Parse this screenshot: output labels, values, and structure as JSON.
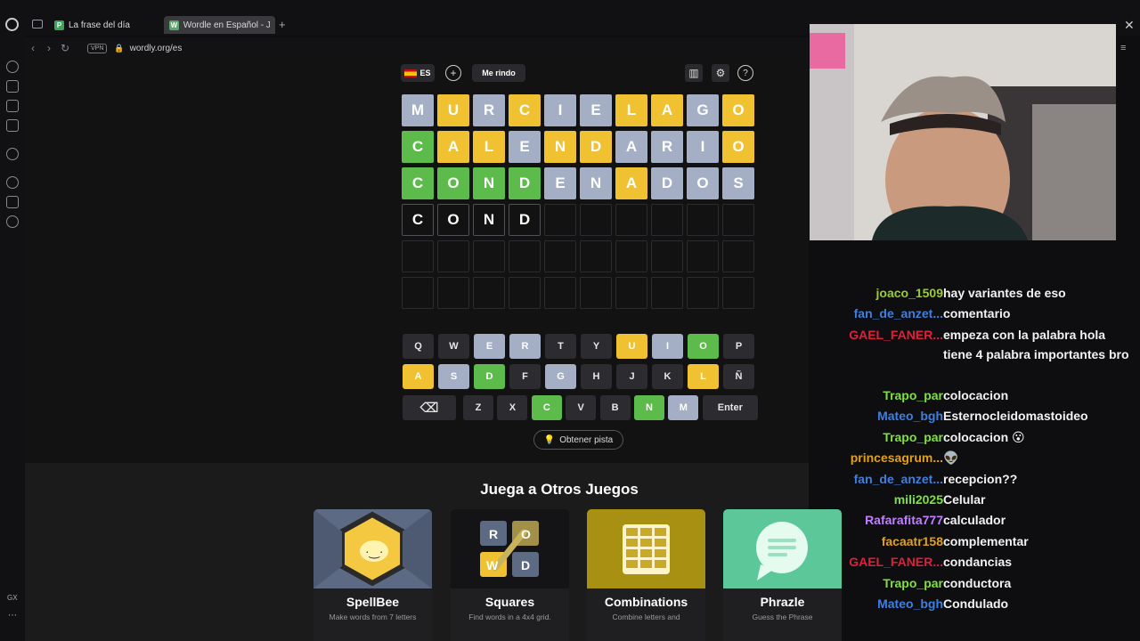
{
  "browser": {
    "tabs": [
      {
        "label": "La frase del día",
        "favicon": "P"
      },
      {
        "label": "Wordle en Español - Jueg",
        "favicon": "W"
      }
    ],
    "new_tab": "+",
    "vpn": "VPN",
    "url": "wordly.org/es"
  },
  "topbar": {
    "lang": "ES",
    "give_up": "Me rindo"
  },
  "board": {
    "rows": [
      [
        [
          "M",
          "a"
        ],
        [
          "U",
          "y"
        ],
        [
          "R",
          "a"
        ],
        [
          "C",
          "y"
        ],
        [
          "I",
          "a"
        ],
        [
          "E",
          "a"
        ],
        [
          "L",
          "y"
        ],
        [
          "A",
          "y"
        ],
        [
          "G",
          "a"
        ],
        [
          "O",
          "y"
        ]
      ],
      [
        [
          "C",
          "g"
        ],
        [
          "A",
          "y"
        ],
        [
          "L",
          "y"
        ],
        [
          "E",
          "a"
        ],
        [
          "N",
          "y"
        ],
        [
          "D",
          "y"
        ],
        [
          "A",
          "a"
        ],
        [
          "R",
          "a"
        ],
        [
          "I",
          "a"
        ],
        [
          "O",
          "y"
        ]
      ],
      [
        [
          "C",
          "g"
        ],
        [
          "O",
          "g"
        ],
        [
          "N",
          "g"
        ],
        [
          "D",
          "g"
        ],
        [
          "E",
          "a"
        ],
        [
          "N",
          "a"
        ],
        [
          "A",
          "y"
        ],
        [
          "D",
          "a"
        ],
        [
          "O",
          "a"
        ],
        [
          "S",
          "a"
        ]
      ],
      [
        [
          "C",
          "t"
        ],
        [
          "O",
          "t"
        ],
        [
          "N",
          "t"
        ],
        [
          "D",
          "t"
        ],
        [
          "",
          "e"
        ],
        [
          "",
          "e"
        ],
        [
          "",
          "e"
        ],
        [
          "",
          "e"
        ],
        [
          "",
          "e"
        ],
        [
          "",
          "e"
        ]
      ],
      [
        [
          "",
          "e"
        ],
        [
          "",
          "e"
        ],
        [
          "",
          "e"
        ],
        [
          "",
          "e"
        ],
        [
          "",
          "e"
        ],
        [
          "",
          "e"
        ],
        [
          "",
          "e"
        ],
        [
          "",
          "e"
        ],
        [
          "",
          "e"
        ],
        [
          "",
          "e"
        ]
      ],
      [
        [
          "",
          "e"
        ],
        [
          "",
          "e"
        ],
        [
          "",
          "e"
        ],
        [
          "",
          "e"
        ],
        [
          "",
          "e"
        ],
        [
          "",
          "e"
        ],
        [
          "",
          "e"
        ],
        [
          "",
          "e"
        ],
        [
          "",
          "e"
        ],
        [
          "",
          "e"
        ]
      ]
    ]
  },
  "keyboard": {
    "rows": [
      [
        [
          "Q",
          ""
        ],
        [
          "W",
          ""
        ],
        [
          "E",
          "a"
        ],
        [
          "R",
          "a"
        ],
        [
          "T",
          ""
        ],
        [
          "Y",
          ""
        ],
        [
          "U",
          "y"
        ],
        [
          "I",
          "a"
        ],
        [
          "O",
          "g"
        ],
        [
          "P",
          ""
        ]
      ],
      [
        [
          "A",
          "y"
        ],
        [
          "S",
          "a"
        ],
        [
          "D",
          "g"
        ],
        [
          "F",
          ""
        ],
        [
          "G",
          "a"
        ],
        [
          "H",
          ""
        ],
        [
          "J",
          ""
        ],
        [
          "K",
          ""
        ],
        [
          "L",
          "y"
        ],
        [
          "Ñ",
          ""
        ]
      ],
      [
        [
          "⌫",
          ""
        ],
        [
          "Z",
          ""
        ],
        [
          "X",
          ""
        ],
        [
          "C",
          "g"
        ],
        [
          "V",
          ""
        ],
        [
          "B",
          ""
        ],
        [
          "N",
          "g"
        ],
        [
          "M",
          "a"
        ],
        [
          "Enter",
          ""
        ]
      ]
    ]
  },
  "hint_label": "Obtener pista",
  "games": {
    "title": "Juega a Otros Juegos",
    "cards": [
      {
        "name": "SpellBee",
        "desc": "Make words from 7 letters"
      },
      {
        "name": "Squares",
        "desc": "Find words in a 4x4 grid."
      },
      {
        "name": "Combinations",
        "desc": "Combine letters and"
      },
      {
        "name": "Phrazle",
        "desc": "Guess the Phrase"
      }
    ],
    "squares_letters": [
      "R",
      "O",
      "W",
      "D"
    ]
  },
  "chat": [
    {
      "user": "joaco_1509",
      "color": "#9acd32",
      "msg": "hay variantes de eso"
    },
    {
      "user": "fan_de_anzet...",
      "color": "#3f7fe0",
      "msg": "comentario"
    },
    {
      "user": "GAEL_FANER...",
      "color": "#e0203a",
      "msg": "empeza con la palabra hola tiene 4 palabra importantes bro"
    },
    {
      "user": "Trapo_par",
      "color": "#7fe040",
      "msg": "colocacion"
    },
    {
      "user": "Mateo_bgh",
      "color": "#3f7fe0",
      "msg": "Esternocleidomastoideo"
    },
    {
      "user": "Trapo_par",
      "color": "#7fe040",
      "msg": "colocacion 😮"
    },
    {
      "user": "princesagrum...",
      "color": "#e0a020",
      "msg": "👽"
    },
    {
      "user": "fan_de_anzet...",
      "color": "#3f7fe0",
      "msg": "recepcion??"
    },
    {
      "user": "mili2025",
      "color": "#7fe040",
      "msg": "Celular"
    },
    {
      "user": "Rafarafita777",
      "color": "#c080ff",
      "msg": "calculador"
    },
    {
      "user": "facaatr158",
      "color": "#e0a020",
      "msg": "complementar"
    },
    {
      "user": "GAEL_FANER...",
      "color": "#e0203a",
      "msg": "condancias"
    },
    {
      "user": "Trapo_par",
      "color": "#7fe040",
      "msg": "conductora"
    },
    {
      "user": "Mateo_bgh",
      "color": "#3f7fe0",
      "msg": "Condulado"
    }
  ]
}
